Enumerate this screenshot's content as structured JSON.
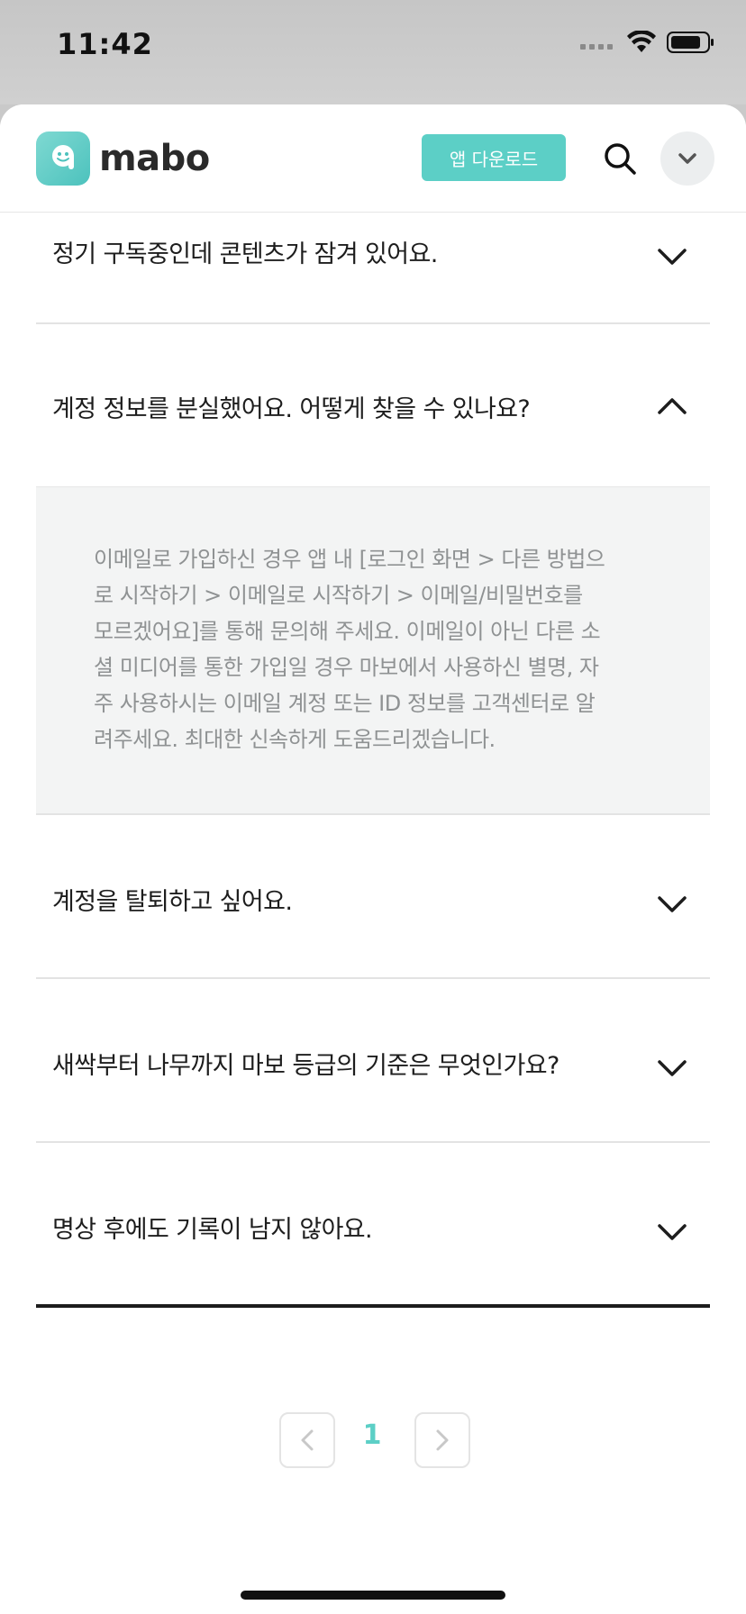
{
  "status_bar": {
    "time": "11:42"
  },
  "header": {
    "logo_text": "mabo",
    "download_label": "앱 다운로드",
    "icons": {
      "search": "search-icon",
      "menu": "chevron-down-icon"
    },
    "colors": {
      "accent": "#5ccfc6"
    }
  },
  "faq": {
    "items": [
      {
        "question": "정기 구독중인데 콘텐츠가 잠겨 있어요.",
        "expanded": false
      },
      {
        "question": "계정 정보를 분실했어요. 어떻게 찾을 수 있나요?",
        "expanded": true,
        "answer_lines": [
          "이메일로 가입하신 경우 앱 내 [로그인 화면 > 다른 방법으",
          "로 시작하기 > 이메일로 시작하기 > 이메일/비밀번호를",
          "모르겠어요]를 통해 문의해 주세요. 이메일이 아닌 다른 소",
          "셜 미디어를 통한 가입일 경우 마보에서 사용하신 별명, 자",
          "주 사용하시는 이메일 계정 또는 ID 정보를 고객센터로 알",
          "려주세요. 최대한 신속하게 도움드리겠습니다."
        ]
      },
      {
        "question": "계정을 탈퇴하고 싶어요.",
        "expanded": false
      },
      {
        "question": "새싹부터 나무까지 마보 등급의 기준은 무엇인가요?",
        "expanded": false
      },
      {
        "question": "명상 후에도 기록이 남지 않아요.",
        "expanded": false
      }
    ]
  },
  "pagination": {
    "current_page": "1"
  }
}
